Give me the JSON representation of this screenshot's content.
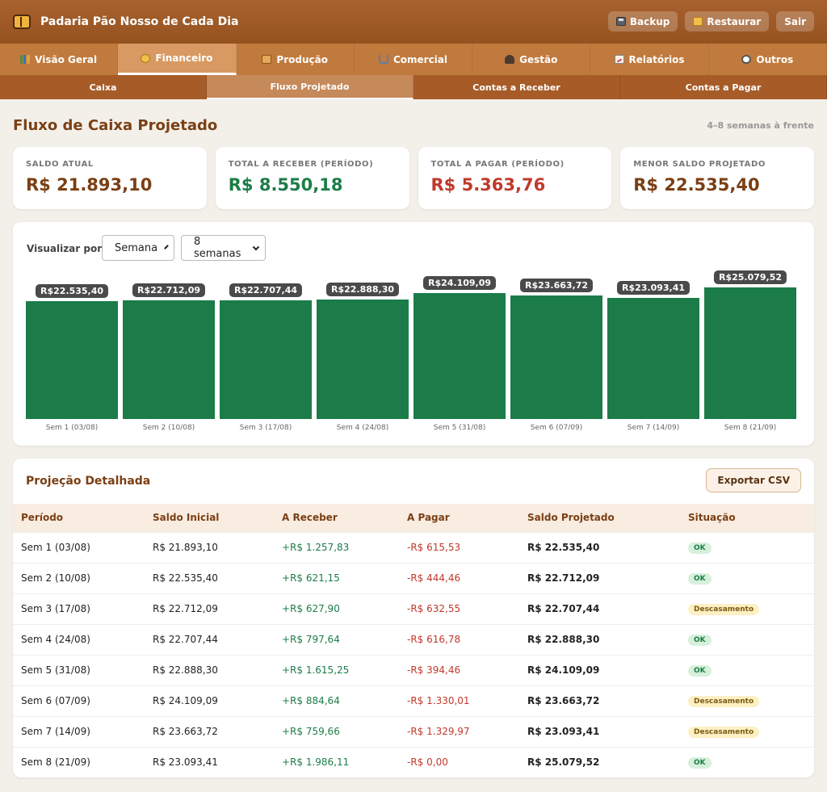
{
  "app": {
    "title": "Padaria Pão Nosso de Cada Dia"
  },
  "header_actions": {
    "backup": "Backup",
    "restore": "Restaurar",
    "logout": "Sair"
  },
  "main_tabs": [
    {
      "label": "Visão Geral",
      "icon": "chart-icon"
    },
    {
      "label": "Financeiro",
      "icon": "coin-icon",
      "active": true
    },
    {
      "label": "Produção",
      "icon": "bread-icon"
    },
    {
      "label": "Comercial",
      "icon": "cart-icon"
    },
    {
      "label": "Gestão",
      "icon": "users-icon"
    },
    {
      "label": "Relatórios",
      "icon": "report-icon"
    },
    {
      "label": "Outros",
      "icon": "gear-icon"
    }
  ],
  "sub_tabs": [
    {
      "label": "Caixa"
    },
    {
      "label": "Fluxo Projetado",
      "active": true
    },
    {
      "label": "Contas a Receber"
    },
    {
      "label": "Contas a Pagar"
    }
  ],
  "page": {
    "title": "Fluxo de Caixa Projetado",
    "subtitle": "4–8 semanas à frente"
  },
  "kpis": [
    {
      "label": "SALDO ATUAL",
      "value": "R$ 21.893,10",
      "tone": "brown"
    },
    {
      "label": "TOTAL A RECEBER (PERÍODO)",
      "value": "R$ 8.550,18",
      "tone": "green"
    },
    {
      "label": "TOTAL A PAGAR (PERÍODO)",
      "value": "R$ 5.363,76",
      "tone": "red"
    },
    {
      "label": "MENOR SALDO PROJETADO",
      "value": "R$ 22.535,40",
      "tone": "brown"
    }
  ],
  "filters": {
    "label": "Visualizar por:",
    "group_by": "Semana",
    "range": "8 semanas"
  },
  "colors": {
    "bar": "#1b7c49",
    "accent": "#7a3f14"
  },
  "chart_data": {
    "type": "bar",
    "categories": [
      "Sem 1 (03/08)",
      "Sem 2 (10/08)",
      "Sem 3 (17/08)",
      "Sem 4 (24/08)",
      "Sem 5 (31/08)",
      "Sem 6 (07/09)",
      "Sem 7 (14/09)",
      "Sem 8 (21/09)"
    ],
    "values": [
      22535.4,
      22712.09,
      22707.44,
      22888.3,
      24109.09,
      23663.72,
      23093.41,
      25079.52
    ],
    "labels": [
      "R$22.535,40",
      "R$22.712,09",
      "R$22.707,44",
      "R$22.888,30",
      "R$24.109,09",
      "R$23.663,72",
      "R$23.093,41",
      "R$25.079,52"
    ],
    "ylim": [
      0,
      27000
    ]
  },
  "table": {
    "title": "Projeção Detalhada",
    "export_label": "Exportar CSV",
    "columns": [
      "Período",
      "Saldo Inicial",
      "A Receber",
      "A Pagar",
      "Saldo Projetado",
      "Situação"
    ],
    "rows": [
      {
        "period": "Sem 1 (03/08)",
        "start": "R$ 21.893,10",
        "recv": "+R$ 1.257,83",
        "pay": "-R$ 615,53",
        "proj": "R$ 22.535,40",
        "status": "OK",
        "tone": "ok"
      },
      {
        "period": "Sem 2 (10/08)",
        "start": "R$ 22.535,40",
        "recv": "+R$ 621,15",
        "pay": "-R$ 444,46",
        "proj": "R$ 22.712,09",
        "status": "OK",
        "tone": "ok"
      },
      {
        "period": "Sem 3 (17/08)",
        "start": "R$ 22.712,09",
        "recv": "+R$ 627,90",
        "pay": "-R$ 632,55",
        "proj": "R$ 22.707,44",
        "status": "Descasamento",
        "tone": "warn"
      },
      {
        "period": "Sem 4 (24/08)",
        "start": "R$ 22.707,44",
        "recv": "+R$ 797,64",
        "pay": "-R$ 616,78",
        "proj": "R$ 22.888,30",
        "status": "OK",
        "tone": "ok"
      },
      {
        "period": "Sem 5 (31/08)",
        "start": "R$ 22.888,30",
        "recv": "+R$ 1.615,25",
        "pay": "-R$ 394,46",
        "proj": "R$ 24.109,09",
        "status": "OK",
        "tone": "ok"
      },
      {
        "period": "Sem 6 (07/09)",
        "start": "R$ 24.109,09",
        "recv": "+R$ 884,64",
        "pay": "-R$ 1.330,01",
        "proj": "R$ 23.663,72",
        "status": "Descasamento",
        "tone": "warn"
      },
      {
        "period": "Sem 7 (14/09)",
        "start": "R$ 23.663,72",
        "recv": "+R$ 759,66",
        "pay": "-R$ 1.329,97",
        "proj": "R$ 23.093,41",
        "status": "Descasamento",
        "tone": "warn"
      },
      {
        "period": "Sem 8 (21/09)",
        "start": "R$ 23.093,41",
        "recv": "+R$ 1.986,11",
        "pay": "-R$ 0,00",
        "proj": "R$ 25.079,52",
        "status": "OK",
        "tone": "ok"
      }
    ]
  }
}
